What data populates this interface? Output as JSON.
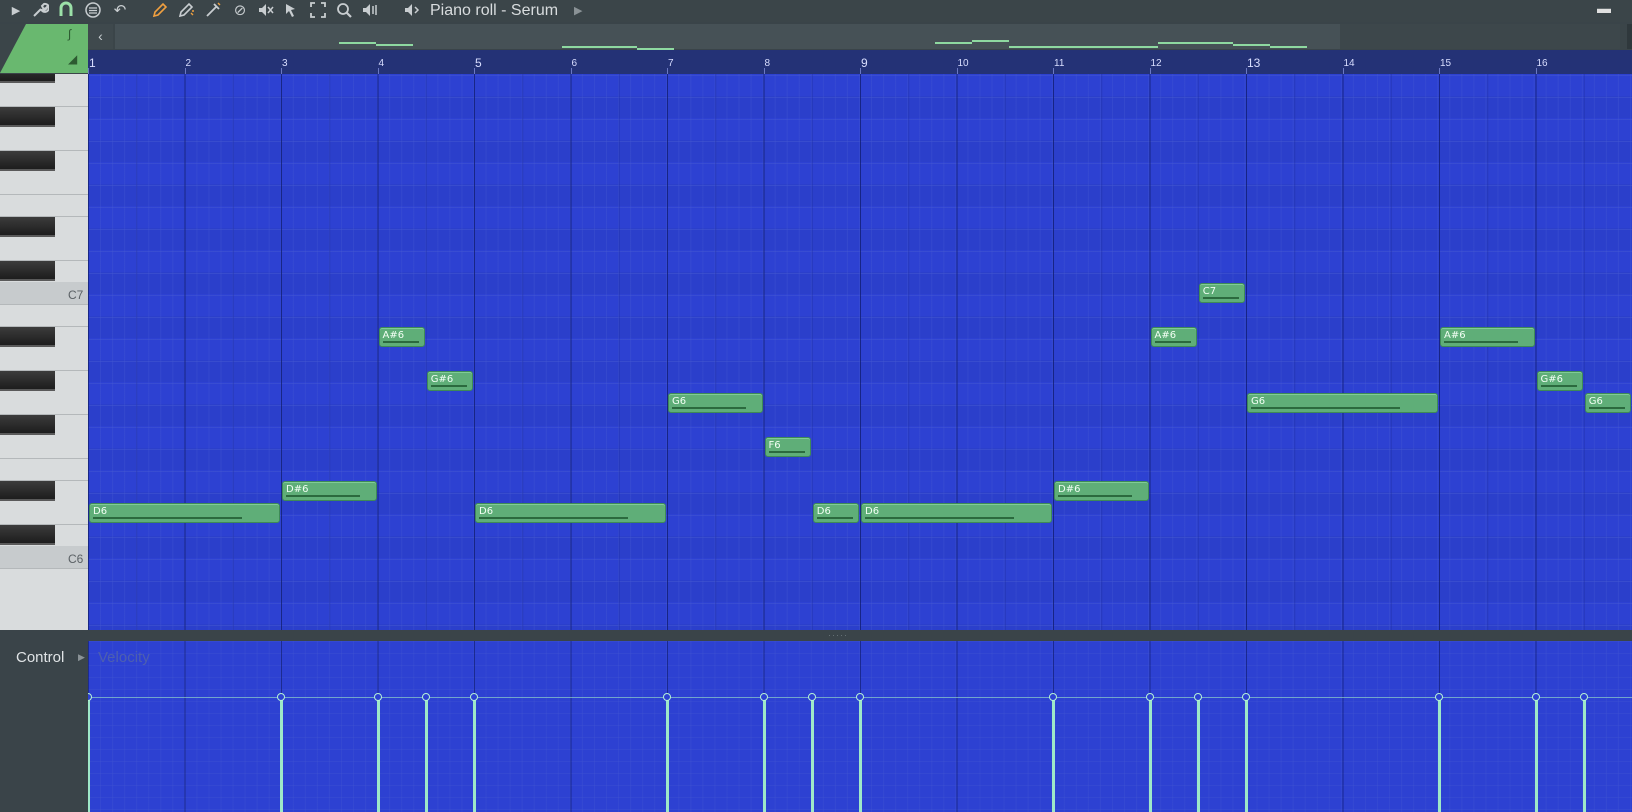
{
  "window": {
    "title": "Piano roll - Serum"
  },
  "toolbar": {
    "icons": [
      "play-arrow",
      "wrench",
      "magnet",
      "menu-circle",
      "undo",
      "pencil",
      "paint-brush",
      "slice",
      "delete",
      "mute",
      "slip",
      "select",
      "zoom",
      "playback"
    ],
    "speaker": "speaker-icon"
  },
  "keyboard": {
    "labels": [
      "C7",
      "C6"
    ]
  },
  "ruler": {
    "bars": [
      "1",
      "2",
      "3",
      "4",
      "5",
      "6",
      "7",
      "8",
      "9",
      "10",
      "11",
      "12",
      "13",
      "14",
      "15",
      "16"
    ]
  },
  "notes": [
    {
      "name": "D6",
      "bar": 1.0,
      "length": 2.0,
      "pitch": "D6"
    },
    {
      "name": "D#6",
      "bar": 3.0,
      "length": 1.0,
      "pitch": "D#6"
    },
    {
      "name": "A#6",
      "bar": 4.0,
      "length": 0.5,
      "pitch": "A#6"
    },
    {
      "name": "G#6",
      "bar": 4.5,
      "length": 0.5,
      "pitch": "G#6"
    },
    {
      "name": "D6",
      "bar": 5.0,
      "length": 2.0,
      "pitch": "D6"
    },
    {
      "name": "G6",
      "bar": 7.0,
      "length": 1.0,
      "pitch": "G6"
    },
    {
      "name": "F6",
      "bar": 8.0,
      "length": 0.5,
      "pitch": "F6"
    },
    {
      "name": "D6",
      "bar": 8.5,
      "length": 0.5,
      "pitch": "D6"
    },
    {
      "name": "D6",
      "bar": 9.0,
      "length": 2.0,
      "pitch": "D6"
    },
    {
      "name": "D#6",
      "bar": 11.0,
      "length": 1.0,
      "pitch": "D#6"
    },
    {
      "name": "A#6",
      "bar": 12.0,
      "length": 0.5,
      "pitch": "A#6"
    },
    {
      "name": "C7",
      "bar": 12.5,
      "length": 0.5,
      "pitch": "C7"
    },
    {
      "name": "G6",
      "bar": 13.0,
      "length": 2.0,
      "pitch": "G6"
    },
    {
      "name": "A#6",
      "bar": 15.0,
      "length": 1.0,
      "pitch": "A#6"
    },
    {
      "name": "G#6",
      "bar": 16.0,
      "length": 0.5,
      "pitch": "G#6"
    },
    {
      "name": "G6",
      "bar": 16.5,
      "length": 0.5,
      "pitch": "G6"
    }
  ],
  "control": {
    "label": "Control",
    "parameter": "Velocity"
  }
}
